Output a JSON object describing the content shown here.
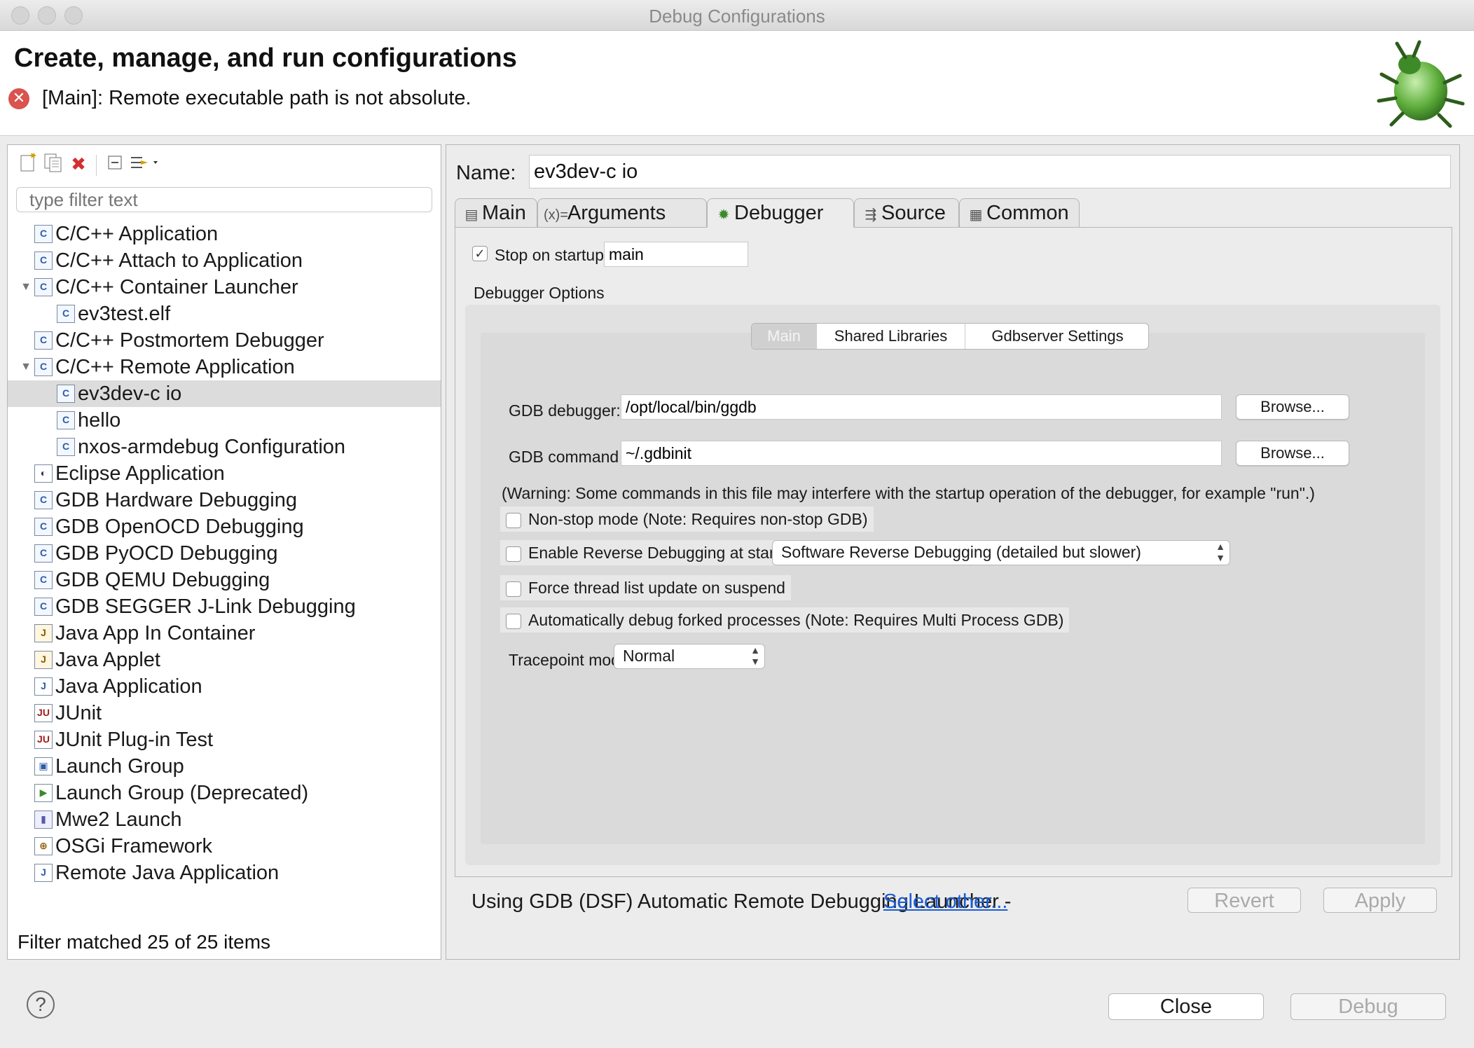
{
  "window": {
    "title": "Debug Configurations"
  },
  "header": {
    "title": "Create, manage, and run configurations",
    "error_message": "[Main]: Remote executable path is not absolute."
  },
  "left_toolbar": {
    "icons": [
      "new-config-icon",
      "duplicate-icon",
      "delete-icon",
      "collapse-all-icon",
      "filter-icon"
    ]
  },
  "filter": {
    "placeholder": "type filter text"
  },
  "tree": {
    "items": [
      {
        "label": "C/C++ Application",
        "level": 0,
        "expanded": null,
        "icon": "c-icon"
      },
      {
        "label": "C/C++ Attach to Application",
        "level": 0,
        "expanded": null,
        "icon": "c-icon"
      },
      {
        "label": "C/C++ Container Launcher",
        "level": 0,
        "expanded": true,
        "icon": "c-icon"
      },
      {
        "label": "ev3test.elf",
        "level": 1,
        "expanded": null,
        "icon": "c-icon"
      },
      {
        "label": "C/C++ Postmortem Debugger",
        "level": 0,
        "expanded": null,
        "icon": "c-icon"
      },
      {
        "label": "C/C++ Remote Application",
        "level": 0,
        "expanded": true,
        "icon": "c-icon"
      },
      {
        "label": "ev3dev-c io",
        "level": 1,
        "expanded": null,
        "icon": "c-icon",
        "selected": true
      },
      {
        "label": "hello",
        "level": 1,
        "expanded": null,
        "icon": "c-icon"
      },
      {
        "label": "nxos-armdebug Configuration",
        "level": 1,
        "expanded": null,
        "icon": "c-icon"
      },
      {
        "label": "Eclipse Application",
        "level": 0,
        "expanded": null,
        "icon": "eclipse-icon"
      },
      {
        "label": "GDB Hardware Debugging",
        "level": 0,
        "expanded": null,
        "icon": "c-icon"
      },
      {
        "label": "GDB OpenOCD Debugging",
        "level": 0,
        "expanded": null,
        "icon": "c-icon"
      },
      {
        "label": "GDB PyOCD Debugging",
        "level": 0,
        "expanded": null,
        "icon": "c-icon"
      },
      {
        "label": "GDB QEMU Debugging",
        "level": 0,
        "expanded": null,
        "icon": "c-icon"
      },
      {
        "label": "GDB SEGGER J-Link Debugging",
        "level": 0,
        "expanded": null,
        "icon": "c-icon"
      },
      {
        "label": "Java App In Container",
        "level": 0,
        "expanded": null,
        "icon": "java-container-icon"
      },
      {
        "label": "Java Applet",
        "level": 0,
        "expanded": null,
        "icon": "java-applet-icon"
      },
      {
        "label": "Java Application",
        "level": 0,
        "expanded": null,
        "icon": "java-app-icon"
      },
      {
        "label": "JUnit",
        "level": 0,
        "expanded": null,
        "icon": "junit-icon"
      },
      {
        "label": "JUnit Plug-in Test",
        "level": 0,
        "expanded": null,
        "icon": "junit-plugin-icon"
      },
      {
        "label": "Launch Group",
        "level": 0,
        "expanded": null,
        "icon": "launch-group-icon"
      },
      {
        "label": "Launch Group (Deprecated)",
        "level": 0,
        "expanded": null,
        "icon": "launch-group-deprecated-icon"
      },
      {
        "label": "Mwe2 Launch",
        "level": 0,
        "expanded": null,
        "icon": "mwe2-icon"
      },
      {
        "label": "OSGi Framework",
        "level": 0,
        "expanded": null,
        "icon": "osgi-icon"
      },
      {
        "label": "Remote Java Application",
        "level": 0,
        "expanded": null,
        "icon": "remote-java-icon"
      }
    ]
  },
  "left_status": "Filter matched 25 of 25 items",
  "config": {
    "name_label": "Name:",
    "name_value": "ev3dev-c io",
    "tabs": [
      {
        "label": "Main",
        "icon": "main-tab-icon"
      },
      {
        "label": "Arguments",
        "icon": "arguments-icon"
      },
      {
        "label": "Debugger",
        "icon": "debugger-icon",
        "active": true
      },
      {
        "label": "Source",
        "icon": "source-icon"
      },
      {
        "label": "Common",
        "icon": "common-icon"
      }
    ],
    "stop_on_startup": {
      "label": "Stop on startup at:",
      "checked": true,
      "value": "main"
    },
    "debugger_options_label": "Debugger Options",
    "subtabs": [
      {
        "label": "Main",
        "active": true
      },
      {
        "label": "Shared Libraries"
      },
      {
        "label": "Gdbserver Settings"
      }
    ],
    "gdb_debugger": {
      "label": "GDB debugger:",
      "value": "/opt/local/bin/ggdb",
      "browse": "Browse..."
    },
    "gdb_command_file": {
      "label": "GDB command file:",
      "value": "~/.gdbinit",
      "browse": "Browse..."
    },
    "warning": "(Warning: Some commands in this file may interfere with the startup operation of the debugger, for example \"run\".)",
    "non_stop": {
      "label": "Non-stop mode (Note: Requires non-stop GDB)",
      "checked": false
    },
    "reverse": {
      "label": "Enable Reverse Debugging at startup using:",
      "checked": false,
      "select": "Software Reverse Debugging (detailed but slower)"
    },
    "force_thread": {
      "label": "Force thread list update on suspend",
      "checked": false
    },
    "auto_forked": {
      "label": "Automatically debug forked processes (Note: Requires Multi Process GDB)",
      "checked": false
    },
    "tracepoint": {
      "label": "Tracepoint mode:",
      "select": "Normal"
    },
    "launcher_text": "Using GDB (DSF) Automatic Remote Debugging Launcher - ",
    "select_other": "Select other...",
    "revert": "Revert",
    "apply": "Apply"
  },
  "footer": {
    "close": "Close",
    "debug": "Debug",
    "help_icon": "help-icon"
  },
  "colors": {
    "link": "#1a5dd6",
    "error": "#d9534f",
    "selection": "#dcdcdc"
  }
}
